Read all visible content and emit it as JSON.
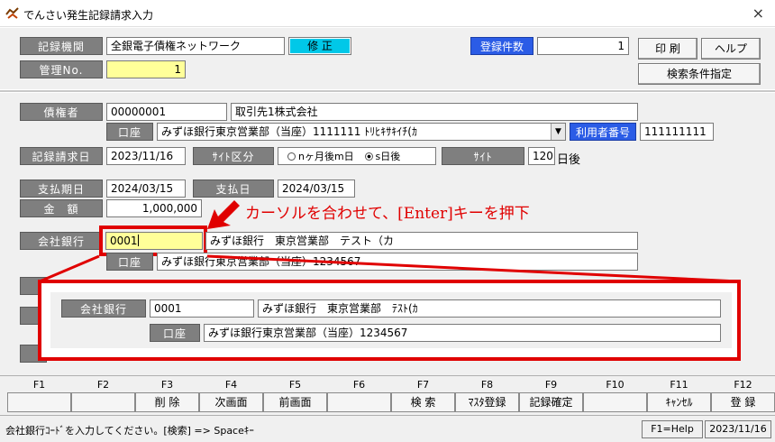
{
  "window": {
    "title": "でんさい発生記録請求入力",
    "close_glyph": "×"
  },
  "header": {
    "institution_label": "記録機関",
    "institution_value": "全銀電子債権ネットワーク",
    "mode_value": "修 正",
    "mgmt_label": "管理No.",
    "mgmt_value": "1",
    "count_label": "登録件数",
    "count_value": "1",
    "print_button": "印 刷",
    "help_button": "ヘルプ",
    "search_cond_button": "検索条件指定"
  },
  "creditor": {
    "label": "債権者",
    "code": "00000001",
    "name": "取引先1株式会社",
    "account_label": "口座",
    "account_value": "みずほ銀行東京営業部（当座）1111111 ﾄﾘﾋｷｻｷｲﾁ(ｶ",
    "user_no_label": "利用者番号",
    "user_no_value": "111111111"
  },
  "request": {
    "date_label": "記録請求日",
    "date_value": "2023/11/16",
    "site_type_label": "ｻｲﾄ区分",
    "radio_months": "nヶ月後m日",
    "radio_days": "s日後",
    "site_label": "ｻｲﾄ",
    "site_value": "120",
    "site_unit": "日後"
  },
  "payment": {
    "due_label": "支払期日",
    "due_value": "2024/03/15",
    "pay_label": "支払日",
    "pay_value": "2024/03/15",
    "amount_label": "金　額",
    "amount_value": "1,000,000"
  },
  "company_bank": {
    "label": "会社銀行",
    "code": "0001",
    "name": "みずほ銀行　東京営業部　テスト（カ",
    "account_label": "口座",
    "account_value": "みずほ銀行東京営業部（当座）1234567"
  },
  "annotation": {
    "text": "カーソルを合わせて、[Enter]キーを押下"
  },
  "zoom": {
    "label": "会社銀行",
    "code": "0001",
    "name": "みずほ銀行　東京営業部　ﾃｽﾄ(ｶ",
    "account_label": "口座",
    "account_value": "みずほ銀行東京営業部（当座）1234567"
  },
  "fkeys": [
    {
      "key": "F1",
      "label": ""
    },
    {
      "key": "F2",
      "label": ""
    },
    {
      "key": "F3",
      "label": "削 除"
    },
    {
      "key": "F4",
      "label": "次画面"
    },
    {
      "key": "F5",
      "label": "前画面"
    },
    {
      "key": "F6",
      "label": ""
    },
    {
      "key": "F7",
      "label": "検 索"
    },
    {
      "key": "F8",
      "label": "ﾏｽﾀ登録"
    },
    {
      "key": "F9",
      "label": "記録確定"
    },
    {
      "key": "F10",
      "label": ""
    },
    {
      "key": "F11",
      "label": "ｷｬﾝｾﾙ"
    },
    {
      "key": "F12",
      "label": "登 録"
    }
  ],
  "status": {
    "message": "会社銀行ｺｰﾄﾞを入力してください。[検索] => Spaceｷｰ",
    "help": "F1=Help",
    "date": "2023/11/16"
  },
  "colors": {
    "accent": "#2b5ce6",
    "highlight": "#e00000",
    "input_yellow": "#ffff99",
    "label_gray": "#7f7f7f"
  }
}
